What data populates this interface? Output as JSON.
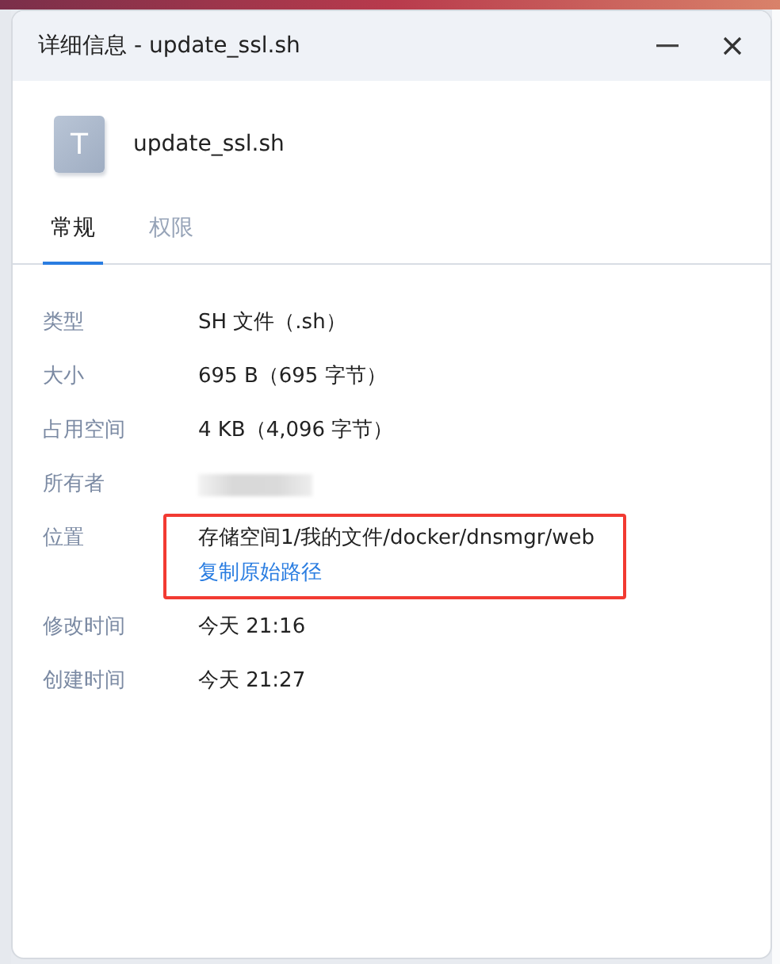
{
  "window": {
    "title": "详细信息 - update_ssl.sh"
  },
  "file": {
    "name": "update_ssl.sh",
    "icon_letter": "T"
  },
  "tabs": [
    {
      "label": "常规",
      "selected": true
    },
    {
      "label": "权限",
      "selected": false
    }
  ],
  "properties": [
    {
      "kind": "text",
      "label": "类型",
      "value": "SH 文件（.sh）",
      "highlighted": false
    },
    {
      "kind": "text",
      "label": "大小",
      "value": "695 B（695 字节）",
      "highlighted": false
    },
    {
      "kind": "text",
      "label": "占用空间",
      "value": "4 KB（4,096 字节）",
      "highlighted": false
    },
    {
      "kind": "redacted",
      "label": "所有者",
      "highlighted": false
    },
    {
      "kind": "location",
      "label": "位置",
      "value": "存储空间1/我的文件/docker/dnsmgr/web",
      "link": "复制原始路径",
      "highlighted": true
    },
    {
      "kind": "text",
      "label": "修改时间",
      "value": "今天 21:16",
      "highlighted": false
    },
    {
      "kind": "text",
      "label": "创建时间",
      "value": "今天 21:27",
      "highlighted": false
    }
  ]
}
